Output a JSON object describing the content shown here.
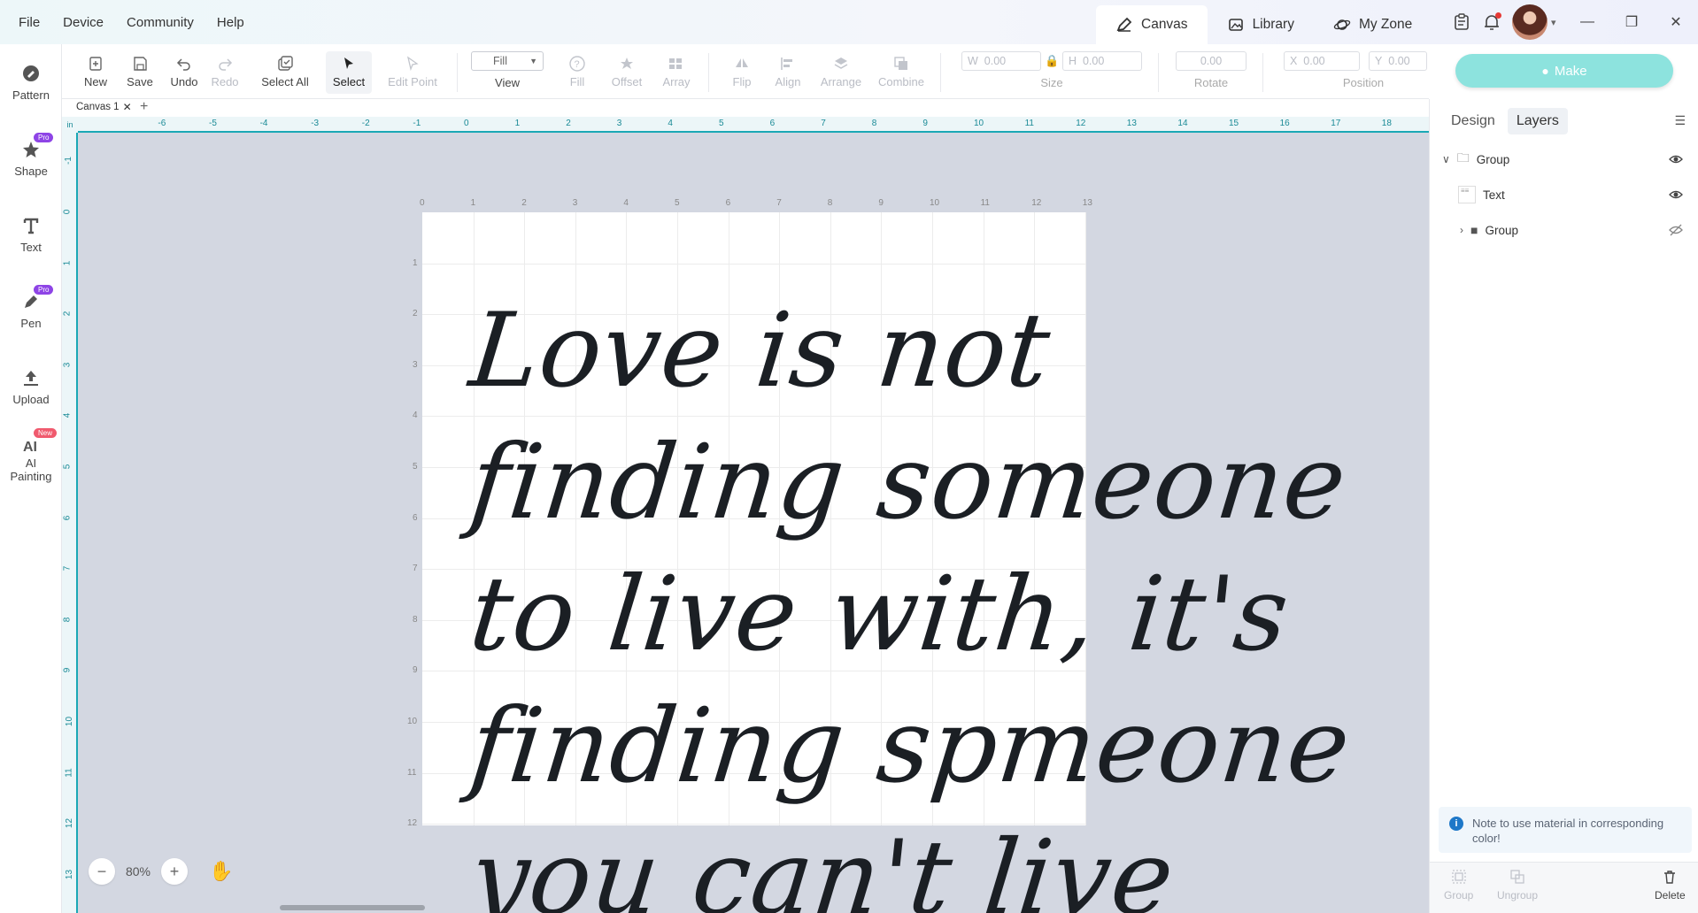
{
  "menu": [
    "File",
    "Device",
    "Community",
    "Help"
  ],
  "topnav": {
    "canvas": "Canvas",
    "library": "Library",
    "myzone": "My Zone"
  },
  "sidebar": {
    "pattern": "Pattern",
    "shape": "Shape",
    "text": "Text",
    "pen": "Pen",
    "upload": "Upload",
    "ai_line1": "AI",
    "ai_line2": "Painting",
    "pro": "Pro",
    "new": "New"
  },
  "toolbar": {
    "new": "New",
    "save": "Save",
    "undo": "Undo",
    "redo": "Redo",
    "select_all": "Select All",
    "select": "Select",
    "edit_point": "Edit Point",
    "view_value": "Fill",
    "view": "View",
    "fill": "Fill",
    "offset": "Offset",
    "array": "Array",
    "flip": "Flip",
    "align": "Align",
    "arrange": "Arrange",
    "combine": "Combine",
    "w_label": "W",
    "w_value": "0.00",
    "h_label": "H",
    "h_value": "0.00",
    "size": "Size",
    "rotate_value": "0.00",
    "rotate": "Rotate",
    "x_label": "X",
    "x_value": "0.00",
    "y_label": "Y",
    "y_value": "0.00",
    "position": "Position"
  },
  "make_button": "Make",
  "canvas": {
    "tab_name": "Canvas 1",
    "ruler_unit": "in",
    "zoom": "80%",
    "text_lines": [
      "Love is not",
      "finding someone",
      "to live with, it's",
      "finding spmeone",
      "you can't live"
    ]
  },
  "panel": {
    "tab_design": "Design",
    "tab_layers": "Layers",
    "layers": [
      "Group",
      "Text",
      "Group"
    ],
    "note": "Note to use material in corresponding color!",
    "group": "Group",
    "ungroup": "Ungroup",
    "delete": "Delete"
  },
  "colors": {
    "accent": "#1aa8b5",
    "make_button": "#8de3de",
    "workspace": "#d3d7e1"
  }
}
